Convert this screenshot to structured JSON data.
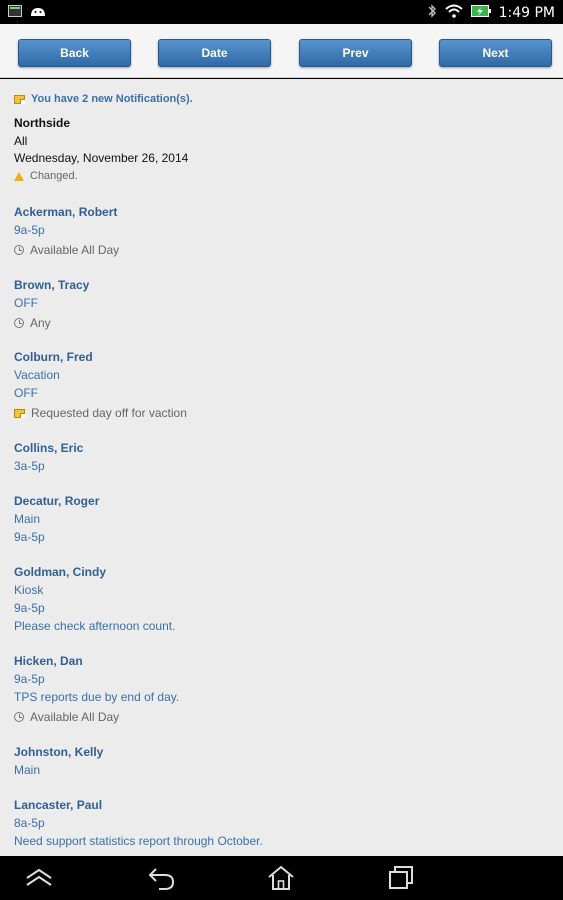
{
  "status_bar": {
    "time": "1:49 PM",
    "left_icons": [
      "terminal-icon",
      "android-icon"
    ],
    "right_icons": [
      "bluetooth-icon",
      "wifi-icon",
      "battery-charging-icon"
    ]
  },
  "toolbar": {
    "back_label": "Back",
    "date_label": "Date",
    "prev_label": "Prev",
    "next_label": "Next"
  },
  "header": {
    "notification": "You have 2 new Notification(s).",
    "location": "Northside",
    "filter": "All",
    "date": "Wednesday, November 26, 2014",
    "changed": "Changed."
  },
  "schedule": [
    {
      "name": "Ackerman, Robert",
      "lines": [
        "9a-5p"
      ],
      "availability": "Available All Day"
    },
    {
      "name": "Brown, Tracy",
      "lines": [
        "OFF"
      ],
      "availability": "Any"
    },
    {
      "name": "Colburn, Fred",
      "lines": [
        "Vacation",
        "OFF"
      ],
      "note": "Requested day off for vaction"
    },
    {
      "name": "Collins, Eric",
      "lines": [
        "3a-5p"
      ]
    },
    {
      "name": "Decatur, Roger",
      "lines": [
        "Main",
        "9a-5p"
      ]
    },
    {
      "name": "Goldman, Cindy",
      "lines": [
        "Kiosk",
        "9a-5p",
        "Please check afternoon count."
      ]
    },
    {
      "name": "Hicken, Dan",
      "lines": [
        "9a-5p",
        "TPS reports due by end of day."
      ],
      "availability": "Available All Day"
    },
    {
      "name": "Johnston, Kelly",
      "lines": [
        "Main"
      ]
    },
    {
      "name": "Lancaster, Paul",
      "lines": [
        "8a-5p",
        "Need support statistics report through October."
      ]
    }
  ],
  "colors": {
    "button_blue": "#3b78b8",
    "link_blue": "#3a6fa8",
    "background": "#ececec"
  }
}
